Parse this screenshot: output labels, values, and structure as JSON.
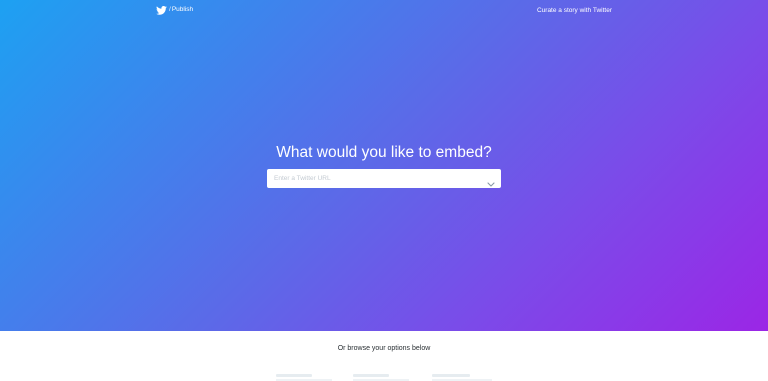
{
  "header": {
    "brand_separator": "/",
    "brand_label": "Publish",
    "curate_link": "Curate a story with Twitter"
  },
  "hero": {
    "headline": "What would you like to embed?",
    "url_input": {
      "placeholder": "Enter a Twitter URL",
      "value": ""
    }
  },
  "lower": {
    "browse_text": "Or browse your options below"
  },
  "icons": {
    "brand": "twitter-bird-icon",
    "dropdown": "chevron-down-icon"
  },
  "colors": {
    "gradient_start": "#1da1f2",
    "gradient_end": "#9b26e6",
    "text_on_hero": "#ffffff",
    "body_text": "#292f33"
  }
}
